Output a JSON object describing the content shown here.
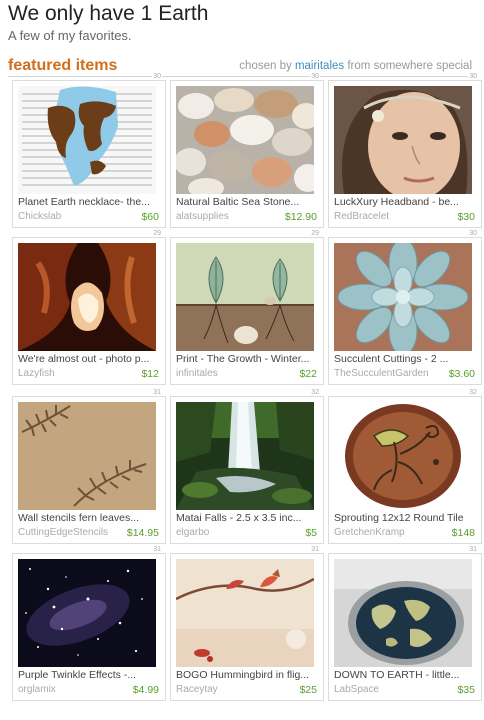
{
  "header": {
    "title": "We only have 1 Earth",
    "subtitle": "A few of my favorites.",
    "featured_label": "featured items",
    "chosen_by": "chosen by",
    "curator": "mairitales",
    "from_text": "from",
    "source": "somewhere special"
  },
  "items": [
    {
      "num": "30",
      "title": "Planet Earth necklace- the...",
      "shop": "Chickslab",
      "price": "$60",
      "icon": "earth-map-image"
    },
    {
      "num": "30",
      "title": "Natural Baltic Sea Stone...",
      "shop": "alatsupplies",
      "price": "$12.90",
      "icon": "sea-stones-image"
    },
    {
      "num": "30",
      "title": "LuckXury Headband - be...",
      "shop": "RedBracelet",
      "price": "$30",
      "icon": "headband-portrait-image"
    },
    {
      "num": "29",
      "title": "We're almost out - photo p...",
      "shop": "Lazyfish",
      "price": "$12",
      "icon": "canyon-photo-image"
    },
    {
      "num": "29",
      "title": "Print - The Growth - Winter...",
      "shop": "infinitales",
      "price": "$22",
      "icon": "growth-print-image"
    },
    {
      "num": "30",
      "title": "Succulent Cuttings - 2 ...",
      "shop": "TheSucculentGarden",
      "price": "$3.60",
      "icon": "succulent-image"
    },
    {
      "num": "31",
      "title": "Wall stencils fern leaves...",
      "shop": "CuttingEdgeStencils",
      "price": "$14.95",
      "icon": "fern-stencil-image"
    },
    {
      "num": "32",
      "title": "Matai Falls - 2.5 x 3.5 inc...",
      "shop": "elgarbo",
      "price": "$5",
      "icon": "waterfall-image"
    },
    {
      "num": "32",
      "title": "Sprouting 12x12 Round Tile",
      "shop": "GretchenKramp",
      "price": "$148",
      "icon": "round-tile-image"
    },
    {
      "num": "31",
      "title": "Purple Twinkle Effects -...",
      "shop": "orglamix",
      "price": "$4.99",
      "icon": "galaxy-image"
    },
    {
      "num": "31",
      "title": "BOGO Hummingbird in flig...",
      "shop": "Raceytay",
      "price": "$25",
      "icon": "hummingbird-image"
    },
    {
      "num": "31",
      "title": "DOWN TO EARTH - little...",
      "shop": "LabSpace",
      "price": "$35",
      "icon": "petri-dish-image"
    }
  ]
}
